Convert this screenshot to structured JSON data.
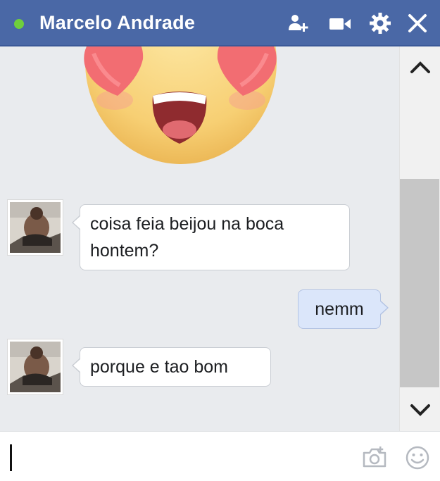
{
  "header": {
    "contact_name": "Marcelo Andrade",
    "status": "online",
    "status_color": "#6fcf3c",
    "bar_color": "#4a68a6",
    "icons": [
      "add-friend-icon",
      "video-call-icon",
      "gear-icon",
      "close-icon"
    ]
  },
  "conversation": {
    "sticker": "heart-eyes-emoji-sticker",
    "messages": [
      {
        "sender": "contact",
        "text_lines": [
          "coisa feia beijou na boca",
          "hontem?"
        ]
      },
      {
        "sender": "me",
        "text_lines": [
          "nemm"
        ]
      },
      {
        "sender": "contact",
        "text_lines": [
          "porque e tao bom"
        ]
      }
    ]
  },
  "scrollbar": {
    "icons": [
      "chevron-up-icon",
      "chevron-down-icon"
    ]
  },
  "composer": {
    "value": "",
    "icons": [
      "camera-icon",
      "emoji-icon"
    ]
  }
}
